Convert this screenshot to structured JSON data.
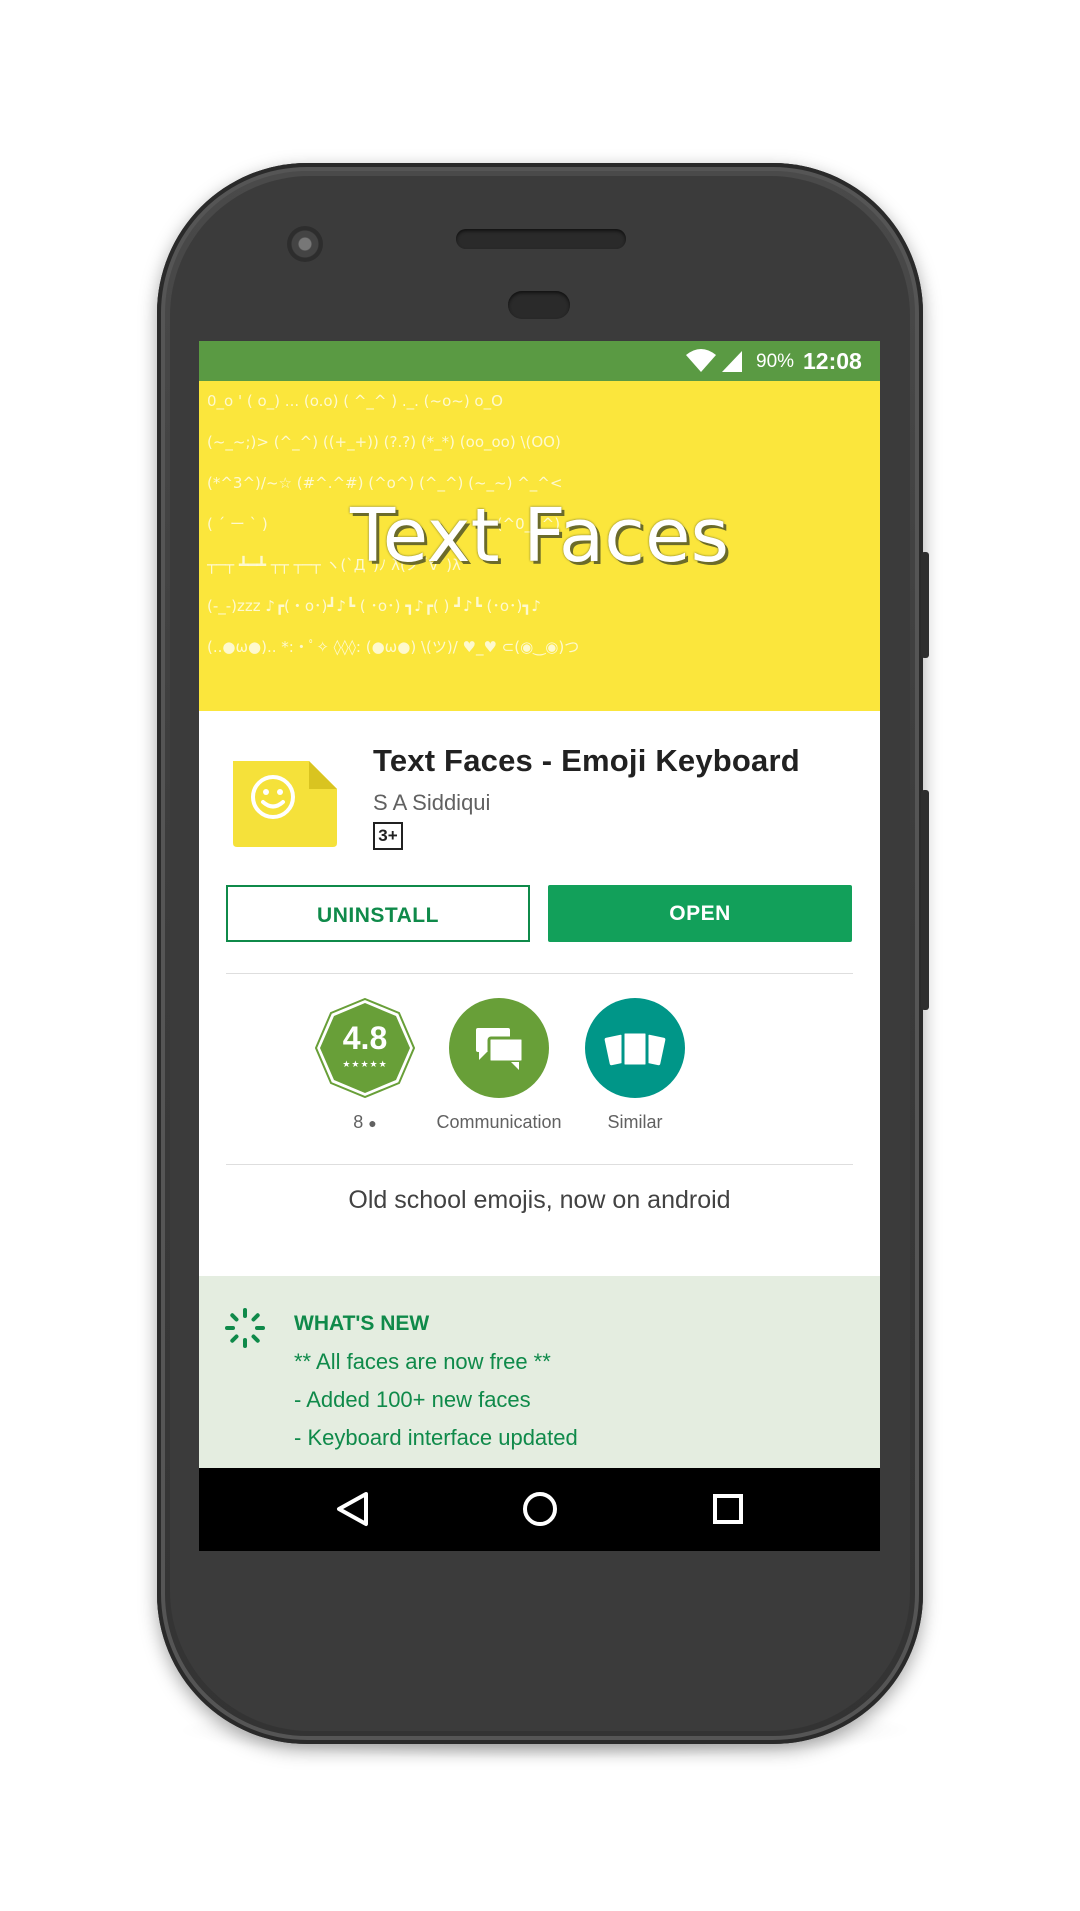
{
  "status_bar": {
    "battery_percent": "90%",
    "time": "12:08",
    "color": "#5a9a43"
  },
  "banner": {
    "title": "Text Faces",
    "background": "#fbe63c"
  },
  "app": {
    "title": "Text Faces - Emoji Keyboard",
    "developer": "S A Siddiqui",
    "age_rating": "3+"
  },
  "actions": {
    "uninstall_label": "UNINSTALL",
    "open_label": "OPEN",
    "accent": "#12a05a"
  },
  "stats": {
    "rating": "4.8",
    "reviews_count": "8",
    "category_label": "Communication",
    "similar_label": "Similar"
  },
  "tagline": "Old school emojis, now on android",
  "whats_new": {
    "heading": "WHAT'S NEW",
    "lines": [
      "** All faces are now free **",
      "- Added 100+ new faces",
      "- Keyboard interface updated"
    ]
  },
  "icons": {
    "status": [
      "wifi-icon",
      "signal-icon",
      "battery-icon"
    ],
    "nav": [
      "back-icon",
      "home-icon",
      "recents-icon"
    ],
    "stats": [
      "rating-badge",
      "category-icon",
      "similar-icon"
    ]
  }
}
